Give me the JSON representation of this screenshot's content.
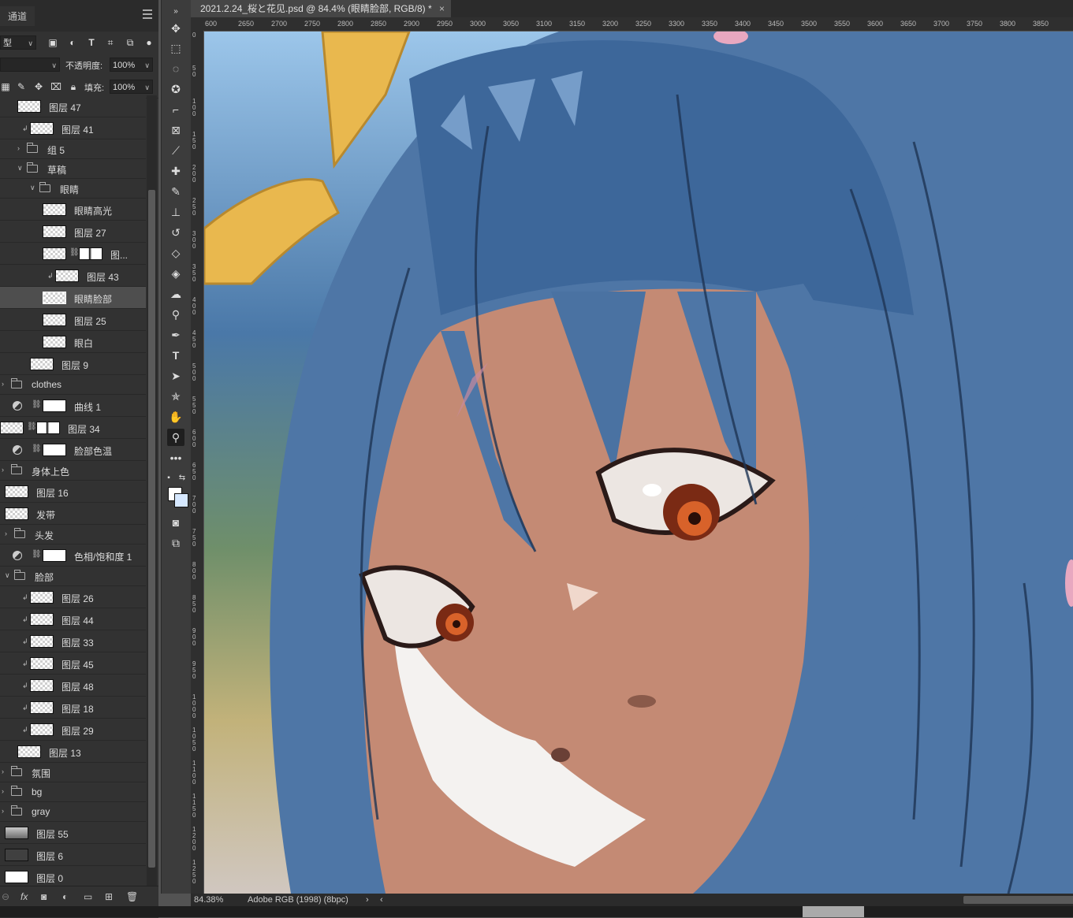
{
  "panel": {
    "tab_label": "通道",
    "filter_kind": "型",
    "blend_mode": "",
    "opacity_label": "不透明度:",
    "opacity_value": "100%",
    "fill_label": "填充:",
    "fill_value": "100%"
  },
  "layers": [
    {
      "name": "图层 47",
      "type": "layer",
      "indent": 22
    },
    {
      "name": "图层 41",
      "type": "layer",
      "indent": 38,
      "clip": true
    },
    {
      "name": "组 5",
      "type": "group",
      "indent": 20,
      "collapsed": true
    },
    {
      "name": "草稿",
      "type": "group",
      "indent": 20,
      "collapsed": false
    },
    {
      "name": "眼睛",
      "type": "group",
      "indent": 36,
      "collapsed": false
    },
    {
      "name": "眼睛高光",
      "type": "layer",
      "indent": 54
    },
    {
      "name": "图层 27",
      "type": "layer",
      "indent": 54
    },
    {
      "name": "图...",
      "type": "layer",
      "indent": 54,
      "mask": true
    },
    {
      "name": "图层 43",
      "type": "layer",
      "indent": 70,
      "clip": true
    },
    {
      "name": "眼睛脸部",
      "type": "layer",
      "indent": 54,
      "selected": true
    },
    {
      "name": "图层 25",
      "type": "layer",
      "indent": 54
    },
    {
      "name": "眼白",
      "type": "layer",
      "indent": 54
    },
    {
      "name": "图层 9",
      "type": "layer",
      "indent": 38
    },
    {
      "name": "clothes",
      "type": "group",
      "indent": 0,
      "collapsed": true
    },
    {
      "name": "曲线 1",
      "type": "adjustment",
      "indent": 14
    },
    {
      "name": "图层 34",
      "type": "layer",
      "indent": 0,
      "mask": true
    },
    {
      "name": "脸部色温",
      "type": "adjustment",
      "indent": 14
    },
    {
      "name": "身体上色",
      "type": "group",
      "indent": 0,
      "collapsed": true
    },
    {
      "name": "图层 16",
      "type": "layer",
      "indent": 6
    },
    {
      "name": "发带",
      "type": "layer",
      "indent": 6
    },
    {
      "name": "头发",
      "type": "group",
      "indent": 4,
      "collapsed": true
    },
    {
      "name": "色相/饱和度 1",
      "type": "adjustment",
      "indent": 14
    },
    {
      "name": "脸部",
      "type": "group",
      "indent": 4,
      "collapsed": false
    },
    {
      "name": "图层 26",
      "type": "layer",
      "indent": 38,
      "clip": true
    },
    {
      "name": "图层 44",
      "type": "layer",
      "indent": 38,
      "clip": true
    },
    {
      "name": "图层 33",
      "type": "layer",
      "indent": 38,
      "clip": true
    },
    {
      "name": "图层 45",
      "type": "layer",
      "indent": 38,
      "clip": true
    },
    {
      "name": "图层 48",
      "type": "layer",
      "indent": 38,
      "clip": true
    },
    {
      "name": "图层 18",
      "type": "layer",
      "indent": 38,
      "clip": true
    },
    {
      "name": "图层 29",
      "type": "layer",
      "indent": 38,
      "clip": true
    },
    {
      "name": "图层 13",
      "type": "layer",
      "indent": 22
    },
    {
      "name": "氛围",
      "type": "group",
      "indent": 0,
      "collapsed": true
    },
    {
      "name": "bg",
      "type": "group",
      "indent": 0,
      "collapsed": true
    },
    {
      "name": "gray",
      "type": "group",
      "indent": 0,
      "collapsed": true
    },
    {
      "name": "图层 55",
      "type": "layer",
      "indent": 6,
      "thumb": "photo"
    },
    {
      "name": "图层 6",
      "type": "layer",
      "indent": 6,
      "thumb": "dark"
    },
    {
      "name": "图层 0",
      "type": "layer",
      "indent": 6,
      "thumb": "white"
    }
  ],
  "document": {
    "tab_title": "2021.2.24_桜と花见.psd @ 84.4% (眼睛脸部, RGB/8) *",
    "close_glyph": "×"
  },
  "ruler_h": [
    "600",
    "2650",
    "2700",
    "2750",
    "2800",
    "2850",
    "2900",
    "2950",
    "3000",
    "3050",
    "3100",
    "3150",
    "3200",
    "3250",
    "3300",
    "3350",
    "3400",
    "3450",
    "3500",
    "3550",
    "3600",
    "3650",
    "3700",
    "3750",
    "3800",
    "3850"
  ],
  "ruler_v": [
    "0",
    "50",
    "100",
    "150",
    "200",
    "250",
    "300",
    "350",
    "400",
    "450",
    "500",
    "550",
    "600",
    "650",
    "700",
    "750",
    "800",
    "850",
    "900",
    "950",
    "1000",
    "1050",
    "1100",
    "1150",
    "1200",
    "1250"
  ],
  "status": {
    "zoom": "84.38%",
    "profile": "Adobe RGB (1998) (8bpc)"
  },
  "colors": {
    "foreground": "#ffffff",
    "background": "#d6e8ff"
  }
}
